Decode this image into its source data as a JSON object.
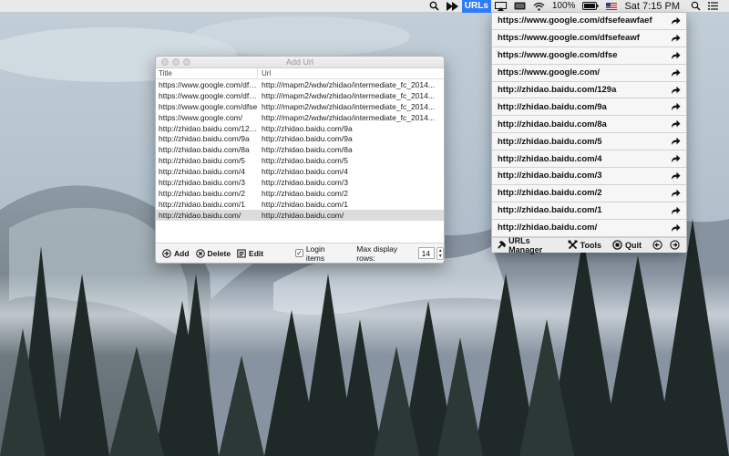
{
  "menubar": {
    "urls_label": "URLs",
    "battery": "100%",
    "clock": "Sat 7:15 PM"
  },
  "window": {
    "title": "Add Url",
    "columns": {
      "title": "Title",
      "url": "Url"
    },
    "rows": [
      {
        "title": "https://www.google.com/dfsefeawfaef",
        "url": "http:///mapm2/wdw/zhidao/intermediate_fc_2014..."
      },
      {
        "title": "https://www.google.com/dfsefeawf",
        "url": "http:///mapm2/wdw/zhidao/intermediate_fc_2014..."
      },
      {
        "title": "https://www.google.com/dfse",
        "url": "http:///mapm2/wdw/zhidao/intermediate_fc_2014..."
      },
      {
        "title": "https://www.google.com/",
        "url": "http:///mapm2/wdw/zhidao/intermediate_fc_2014..."
      },
      {
        "title": "http://zhidao.baidu.com/129a",
        "url": "http://zhidao.baidu.com/9a"
      },
      {
        "title": "http://zhidao.baidu.com/9a",
        "url": "http://zhidao.baidu.com/9a"
      },
      {
        "title": "http://zhidao.baidu.com/8a",
        "url": "http://zhidao.baidu.com/8a"
      },
      {
        "title": "http://zhidao.baidu.com/5",
        "url": "http://zhidao.baidu.com/5"
      },
      {
        "title": "http://zhidao.baidu.com/4",
        "url": "http://zhidao.baidu.com/4"
      },
      {
        "title": "http://zhidao.baidu.com/3",
        "url": "http://zhidao.baidu.com/3"
      },
      {
        "title": "http://zhidao.baidu.com/2",
        "url": "http://zhidao.baidu.com/2"
      },
      {
        "title": "http://zhidao.baidu.com/1",
        "url": "http://zhidao.baidu.com/1"
      },
      {
        "title": "http://zhidao.baidu.com/",
        "url": "http://zhidao.baidu.com/"
      }
    ],
    "footer": {
      "add_label": "Add",
      "delete_label": "Delete",
      "edit_label": "Edit",
      "login_label": "Login items",
      "login_checked": true,
      "max_rows_label": "Max display rows:",
      "max_rows_value": "14"
    }
  },
  "dropdown": {
    "items": [
      "https://www.google.com/dfsefeawfaef",
      "https://www.google.com/dfsefeawf",
      "https://www.google.com/dfse",
      "https://www.google.com/",
      "http://zhidao.baidu.com/129a",
      "http://zhidao.baidu.com/9a",
      "http://zhidao.baidu.com/8a",
      "http://zhidao.baidu.com/5",
      "http://zhidao.baidu.com/4",
      "http://zhidao.baidu.com/3",
      "http://zhidao.baidu.com/2",
      "http://zhidao.baidu.com/1",
      "http://zhidao.baidu.com/"
    ],
    "tools": {
      "manager_label": "URLs Manager",
      "tools_label": "Tools",
      "quit_label": "Quit"
    }
  },
  "colors": {
    "accent": "#2e7cf6",
    "selected_row": "#dcdcdc"
  }
}
